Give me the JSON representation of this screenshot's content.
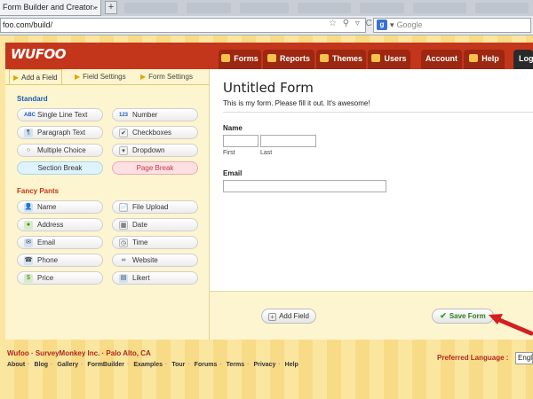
{
  "browser": {
    "tab_title": "Form Builder and Creator - NO L...",
    "tab_close": "×",
    "new_tab": "+",
    "url": "foo.com/build/",
    "search_placeholder": "Google",
    "search_badge": "g",
    "search_caret": "▾",
    "url_icons": "☆ ⚲ ▿ C"
  },
  "header": {
    "logo": "WUFOO",
    "nav": [
      {
        "label": "Forms",
        "icon": "forms-icon"
      },
      {
        "label": "Reports",
        "icon": "reports-icon"
      },
      {
        "label": "Themes",
        "icon": "themes-icon"
      },
      {
        "label": "Users",
        "icon": "users-icon"
      },
      {
        "label": "Account"
      },
      {
        "label": "Help",
        "icon": "help-icon"
      },
      {
        "label": "Log"
      }
    ]
  },
  "sidepanel": {
    "tabs": [
      "Add a Field",
      "Field Settings",
      "Form Settings"
    ],
    "tab_arrow": "▶",
    "standard_label": "Standard",
    "standard": [
      {
        "label": "Single Line Text",
        "icon": "ABC"
      },
      {
        "label": "Number",
        "icon": "123"
      },
      {
        "label": "Paragraph Text",
        "icon": "¶"
      },
      {
        "label": "Checkboxes",
        "icon": "✔"
      },
      {
        "label": "Multiple Choice",
        "icon": "○"
      },
      {
        "label": "Dropdown",
        "icon": "▾"
      },
      {
        "label": "Section Break"
      },
      {
        "label": "Page Break"
      }
    ],
    "fancy_label": "Fancy Pants",
    "fancy": [
      {
        "label": "Name",
        "icon": "👤"
      },
      {
        "label": "File Upload",
        "icon": "📄"
      },
      {
        "label": "Address",
        "icon": "●"
      },
      {
        "label": "Date",
        "icon": "▦"
      },
      {
        "label": "Email",
        "icon": "✉"
      },
      {
        "label": "Time",
        "icon": "◷"
      },
      {
        "label": "Phone",
        "icon": "☎"
      },
      {
        "label": "Website",
        "icon": "∞"
      },
      {
        "label": "Price",
        "icon": "$"
      },
      {
        "label": "Likert",
        "icon": "▤"
      }
    ]
  },
  "form": {
    "title": "Untitled Form",
    "description": "This is my form. Please fill it out. It's awesome!",
    "name_label": "Name",
    "name_first": "First",
    "name_last": "Last",
    "email_label": "Email"
  },
  "actions": {
    "add_field": "Add Field",
    "add_icon": "+",
    "save_form": "Save Form",
    "save_icon": "✔"
  },
  "footer": {
    "brand": "Wufoo · SurveyMonkey Inc. · Palo Alto, CA",
    "links": [
      "About",
      "Blog",
      "Gallery",
      "FormBuilder",
      "Examples",
      "Tour",
      "Forums",
      "Terms",
      "Privacy",
      "Help"
    ],
    "link_separator": "·",
    "language_label": "Preferred Language :",
    "language_value": "Engl"
  },
  "colors": {
    "brand_red": "#c3361b",
    "nav_red": "#9d2710",
    "panel_yellow": "#fdf5cf",
    "link_blue": "#1b5bb8"
  }
}
